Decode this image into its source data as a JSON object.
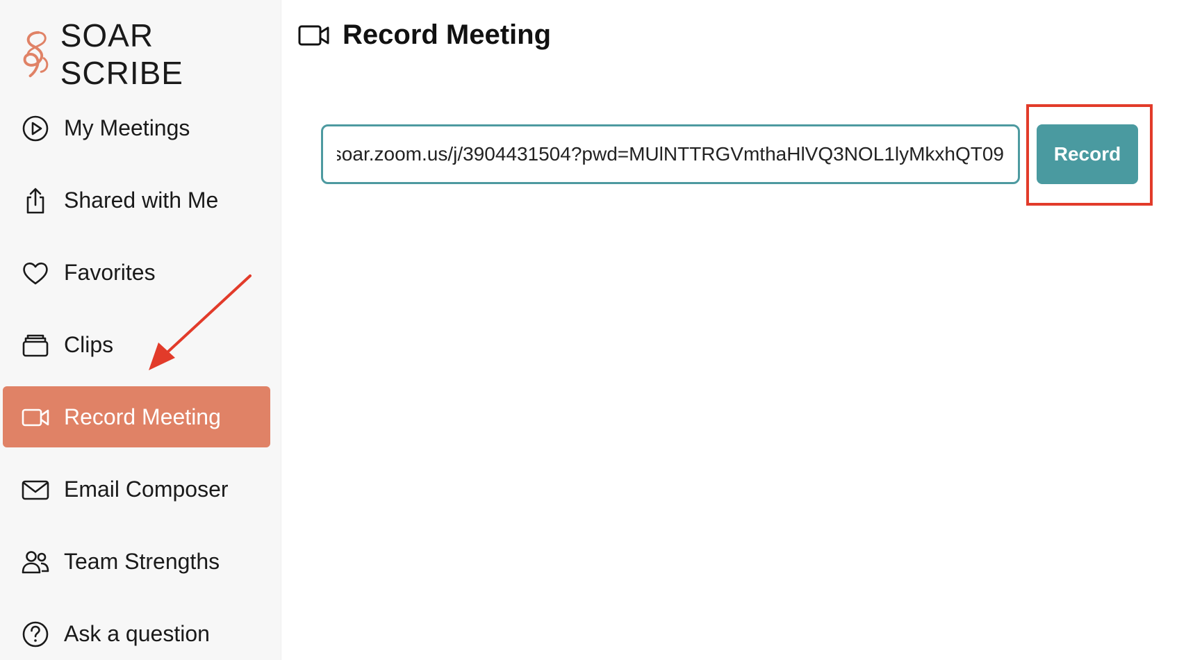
{
  "app": {
    "logo_text": "SOAR SCRIBE",
    "brand_color": "#e08266",
    "accent_color": "#4a9aa0"
  },
  "sidebar": {
    "items": [
      {
        "label": "My Meetings",
        "icon": "play-circle-icon"
      },
      {
        "label": "Shared with Me",
        "icon": "share-icon"
      },
      {
        "label": "Favorites",
        "icon": "heart-icon"
      },
      {
        "label": "Clips",
        "icon": "clips-icon"
      },
      {
        "label": "Record Meeting",
        "icon": "video-camera-icon",
        "active": true
      },
      {
        "label": "Email Composer",
        "icon": "envelope-icon"
      },
      {
        "label": "Team Strengths",
        "icon": "people-icon"
      },
      {
        "label": "Ask a question",
        "icon": "question-circle-icon"
      }
    ]
  },
  "main": {
    "title": "Record Meeting",
    "title_icon": "video-camera-icon",
    "meeting_url": "soar.zoom.us/j/3904431504?pwd=MUlNTTRGVmthaHlVQ3NOL1lyMkxhQT09",
    "record_label": "Record"
  },
  "annotations": {
    "highlight_color": "#e23b2a"
  }
}
